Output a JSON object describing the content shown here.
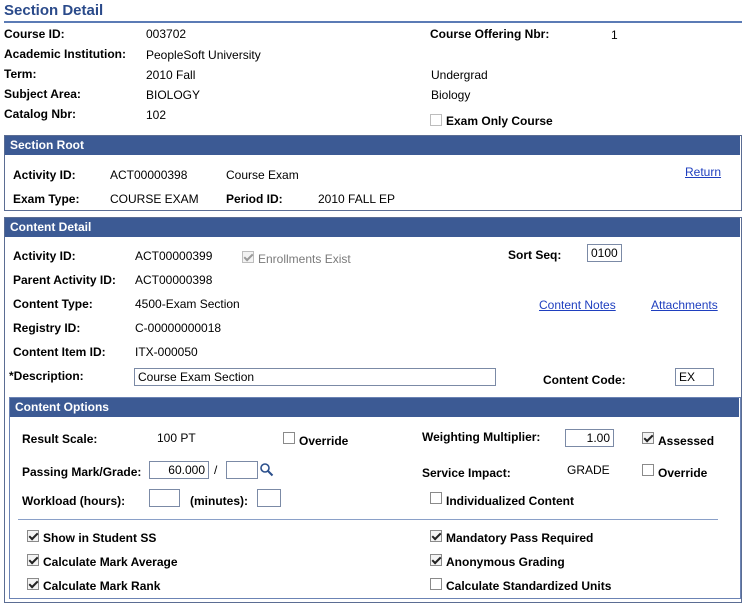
{
  "page_title": "Section Detail",
  "header": {
    "course_id_label": "Course ID:",
    "course_id": "003702",
    "course_offering_label": "Course Offering Nbr:",
    "course_offering": "1",
    "institution_label": "Academic Institution:",
    "institution": "PeopleSoft University",
    "term_label": "Term:",
    "term": "2010 Fall",
    "career": "Undergrad",
    "subject_label": "Subject Area:",
    "subject": "BIOLOGY",
    "subject_desc": "Biology",
    "catalog_label": "Catalog Nbr:",
    "catalog": "102",
    "exam_only_label": "Exam Only Course",
    "exam_only_checked": false
  },
  "section_root": {
    "title": "Section Root",
    "activity_id_label": "Activity ID:",
    "activity_id": "ACT00000398",
    "activity_desc": "Course Exam",
    "return_link": "Return",
    "exam_type_label": "Exam Type:",
    "exam_type": "COURSE EXAM",
    "period_id_label": "Period ID:",
    "period_id": "2010 FALL EP"
  },
  "content_detail": {
    "title": "Content Detail",
    "activity_id_label": "Activity ID:",
    "activity_id": "ACT00000399",
    "enrollments_exist_label": "Enrollments Exist",
    "enrollments_exist_checked": true,
    "sort_seq_label": "Sort Seq:",
    "sort_seq": "0100",
    "parent_activity_label": "Parent Activity ID:",
    "parent_activity": "ACT00000398",
    "content_type_label": "Content Type:",
    "content_type": "4500-Exam Section",
    "content_notes_link": "Content Notes",
    "attachments_link": "Attachments",
    "registry_label": "Registry ID:",
    "registry": "C-00000000018",
    "content_item_label": "Content Item ID:",
    "content_item": "ITX-000050",
    "description_label": "*Description:",
    "description": "Course Exam Section",
    "content_code_label": "Content Code:",
    "content_code": "EX"
  },
  "content_options": {
    "title": "Content Options",
    "result_scale_label": "Result Scale:",
    "result_scale": "100 PT",
    "result_override_label": "Override",
    "result_override_checked": false,
    "weighting_label": "Weighting Multiplier:",
    "weighting": "1.00",
    "assessed_label": "Assessed",
    "assessed_checked": true,
    "passing_label": "Passing Mark/Grade:",
    "passing_mark": "60.000",
    "passing_slash": "/",
    "passing_grade": "",
    "service_impact_label": "Service Impact:",
    "service_impact": "GRADE",
    "service_override_label": "Override",
    "service_override_checked": false,
    "workload_label": "Workload (hours):",
    "workload_hours": "",
    "minutes_label": "(minutes):",
    "workload_minutes": "",
    "individualized_label": "Individualized Content",
    "individualized_checked": false,
    "show_student_label": "Show in Student SS",
    "show_student_checked": true,
    "mandatory_pass_label": "Mandatory Pass Required",
    "mandatory_pass_checked": true,
    "calc_mark_avg_label": "Calculate Mark Average",
    "calc_mark_avg_checked": true,
    "anonymous_label": "Anonymous Grading",
    "anonymous_checked": true,
    "calc_mark_rank_label": "Calculate Mark Rank",
    "calc_mark_rank_checked": true,
    "calc_std_units_label": "Calculate Standardized Units",
    "calc_std_units_checked": false
  },
  "colors": {
    "section_bar": "#3c5a94",
    "title": "#2a4a8a",
    "link": "#1f3fbf"
  }
}
